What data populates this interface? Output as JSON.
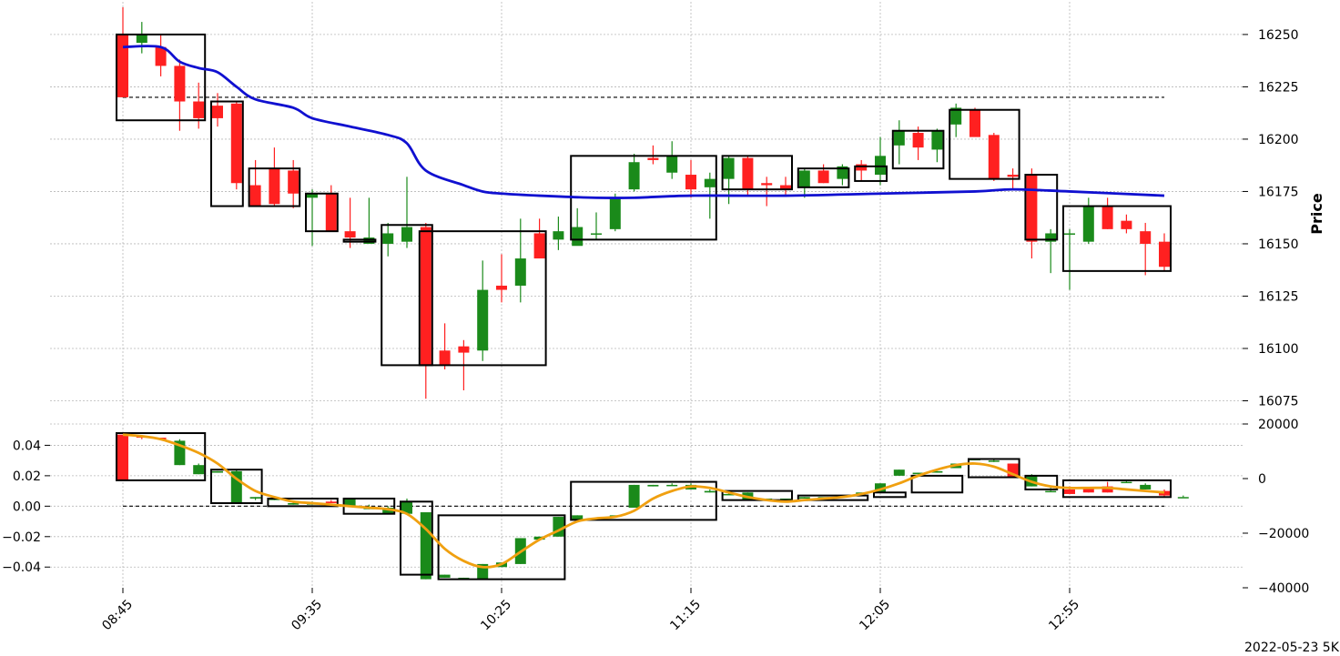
{
  "chart_data": [
    {
      "type": "candlestick",
      "panel": "price",
      "ylabel": "Price",
      "ylim": [
        16070,
        16263
      ],
      "yticks": [
        16075,
        16100,
        16125,
        16150,
        16175,
        16200,
        16225,
        16250
      ],
      "reference_line": 16220,
      "x_tick_labels": [
        "08:45",
        "09:35",
        "10:25",
        "11:15",
        "12:05",
        "12:55"
      ],
      "x_tick_indices": [
        0,
        10,
        20,
        30,
        40,
        50
      ],
      "colors": {
        "up": "#1a8a1a",
        "down": "#ff2020",
        "avg_line": "#1010d0",
        "box": "#000000",
        "ref_line": "#000000"
      },
      "candles": [
        [
          16250,
          16263,
          16220,
          16220
        ],
        [
          16246,
          16256,
          16241,
          16250
        ],
        [
          16244,
          16250,
          16230,
          16235
        ],
        [
          16235,
          16238,
          16204,
          16218
        ],
        [
          16218,
          16227,
          16205,
          16210
        ],
        [
          16216,
          16222,
          16206,
          16210
        ],
        [
          16217,
          16218,
          16176,
          16179
        ],
        [
          16178,
          16190,
          16168,
          16168
        ],
        [
          16186,
          16196,
          16168,
          16169
        ],
        [
          16185,
          16190,
          16167,
          16174
        ],
        [
          16172,
          16176,
          16149,
          16174
        ],
        [
          16174,
          16178,
          16158,
          16156
        ],
        [
          16156,
          16172,
          16148,
          16153
        ],
        [
          16150,
          16172,
          16151,
          16153
        ],
        [
          16150,
          16160,
          16144,
          16155
        ],
        [
          16151,
          16182,
          16148,
          16158
        ],
        [
          16158,
          16160,
          16076,
          16092
        ],
        [
          16099,
          16112,
          16090,
          16092
        ],
        [
          16101,
          16104,
          16080,
          16098
        ],
        [
          16099,
          16142,
          16094,
          16128
        ],
        [
          16130,
          16145,
          16122,
          16128
        ],
        [
          16130,
          16162,
          16122,
          16143
        ],
        [
          16155,
          16162,
          16145,
          16143
        ],
        [
          16152,
          16163,
          16147,
          16156
        ],
        [
          16149,
          16167,
          16152,
          16158
        ],
        [
          16155,
          16165,
          16152,
          16155
        ],
        [
          16157,
          16174,
          16156,
          16172
        ],
        [
          16176,
          16193,
          16175,
          16189
        ],
        [
          16191,
          16197,
          16188,
          16190
        ],
        [
          16184,
          16199,
          16181,
          16192
        ],
        [
          16183,
          16190,
          16172,
          16176
        ],
        [
          16177,
          16184,
          16162,
          16181
        ],
        [
          16181,
          16192,
          16169,
          16191
        ],
        [
          16191,
          16192,
          16173,
          16176
        ],
        [
          16179,
          16182,
          16168,
          16178
        ],
        [
          16178,
          16182,
          16173,
          16176
        ],
        [
          16177,
          16186,
          16172,
          16185
        ],
        [
          16185,
          16188,
          16179,
          16179
        ],
        [
          16181,
          16188,
          16178,
          16187
        ],
        [
          16188,
          16190,
          16180,
          16185
        ],
        [
          16183,
          16201,
          16178,
          16192
        ],
        [
          16197,
          16209,
          16188,
          16204
        ],
        [
          16203,
          16206,
          16190,
          16196
        ],
        [
          16195,
          16205,
          16189,
          16204
        ],
        [
          16207,
          16217,
          16201,
          16215
        ],
        [
          16214,
          16215,
          16202,
          16201
        ],
        [
          16202,
          16203,
          16180,
          16181
        ],
        [
          16183,
          16186,
          16176,
          16182
        ],
        [
          16183,
          16186,
          16143,
          16151
        ],
        [
          16151,
          16157,
          16136,
          16155
        ],
        [
          16155,
          16157,
          16128,
          16155
        ],
        [
          16151,
          16172,
          16150,
          16168
        ],
        [
          16168,
          16172,
          16157,
          16157
        ],
        [
          16161,
          16164,
          16155,
          16157
        ],
        [
          16156,
          16160,
          16135,
          16150
        ],
        [
          16151,
          16155,
          16137,
          16139
        ]
      ],
      "avg_line": [
        [
          0,
          16244
        ],
        [
          2,
          16244
        ],
        [
          3,
          16237
        ],
        [
          4,
          16234
        ],
        [
          5,
          16232
        ],
        [
          6,
          16225
        ],
        [
          7,
          16219
        ],
        [
          9,
          16215
        ],
        [
          10,
          16210
        ],
        [
          12,
          16206
        ],
        [
          14,
          16202
        ],
        [
          15,
          16198
        ],
        [
          16,
          16185
        ],
        [
          18,
          16178
        ],
        [
          19,
          16175
        ],
        [
          20,
          16174
        ],
        [
          22,
          16173
        ],
        [
          25,
          16172
        ],
        [
          27,
          16172
        ],
        [
          30,
          16173
        ],
        [
          35,
          16173
        ],
        [
          40,
          16174
        ],
        [
          45,
          16175
        ],
        [
          47,
          16176
        ],
        [
          50,
          16175
        ],
        [
          55,
          16173
        ]
      ],
      "boxes": [
        [
          0,
          3,
          16250,
          16209
        ],
        [
          3,
          6,
          16218,
          16168
        ],
        [
          6,
          7,
          16186,
          16168
        ],
        [
          7,
          9,
          16174,
          16156
        ],
        [
          9,
          11,
          16152,
          16151
        ],
        [
          11,
          12,
          16159,
          16092
        ],
        [
          12,
          17,
          16156,
          16092
        ],
        [
          17,
          24,
          16192,
          16152
        ],
        [
          24,
          28,
          16192,
          16176
        ],
        [
          28,
          29,
          16186,
          16177
        ],
        [
          29,
          30,
          16187,
          16180
        ],
        [
          30,
          33,
          16204,
          16186
        ],
        [
          33,
          36,
          16214,
          16181
        ],
        [
          36,
          37,
          16183,
          16152
        ],
        [
          37,
          41,
          16168,
          16137
        ]
      ]
    },
    {
      "type": "candlestick",
      "panel": "indicator",
      "left_ylim": [
        -0.0536,
        0.054
      ],
      "left_yticks": [
        0.04,
        0.02,
        0.0,
        -0.02,
        -0.04
      ],
      "left_ytick_labels": [
        "0.04",
        "0.02",
        "0.00",
        "−0.02",
        "−0.04"
      ],
      "right_ylim": [
        -40000,
        20000
      ],
      "right_yticks": [
        20000,
        0,
        -20000,
        -40000
      ],
      "right_ytick_labels": [
        "20000",
        "0",
        "−20000",
        "−40000"
      ],
      "reference_line": 0.0,
      "colors": {
        "up": "#1a8a1a",
        "down": "#ff2020",
        "avg_line": "#f0a010",
        "box": "#000000"
      },
      "candles": [
        [
          0.047,
          0.047,
          0.017,
          0.017
        ],
        [
          0.046,
          0.046,
          0.044,
          0.045
        ],
        [
          0.045,
          0.045,
          0.044,
          0.044
        ],
        [
          0.027,
          0.044,
          0.027,
          0.043
        ],
        [
          0.021,
          0.028,
          0.021,
          0.027
        ],
        [
          0.022,
          0.023,
          0.022,
          0.023
        ],
        [
          0.002,
          0.024,
          0.002,
          0.023
        ],
        [
          0.005,
          0.006,
          0.004,
          0.006
        ],
        [
          0.004,
          0.006,
          0.004,
          0.005
        ],
        [
          0.001,
          0.003,
          0.001,
          0.002
        ],
        [
          0.001,
          0.003,
          0.001,
          0.002
        ],
        [
          0.003,
          0.004,
          0.002,
          0.002
        ],
        [
          0.0,
          0.005,
          0.0,
          0.005
        ],
        [
          -0.002,
          0.001,
          -0.002,
          -0.001
        ],
        [
          -0.005,
          0.0,
          -0.005,
          -0.001
        ],
        [
          -0.005,
          0.005,
          -0.005,
          0.003
        ],
        [
          -0.048,
          -0.005,
          -0.048,
          -0.004
        ],
        [
          -0.047,
          -0.045,
          -0.047,
          -0.045
        ],
        [
          -0.048,
          -0.047,
          -0.048,
          -0.047
        ],
        [
          -0.048,
          -0.038,
          -0.048,
          -0.038
        ],
        [
          -0.04,
          -0.037,
          -0.04,
          -0.037
        ],
        [
          -0.038,
          -0.021,
          -0.038,
          -0.021
        ],
        [
          -0.022,
          -0.02,
          -0.022,
          -0.02
        ],
        [
          -0.02,
          -0.007,
          -0.02,
          -0.007
        ],
        [
          -0.009,
          -0.006,
          -0.009,
          -0.006
        ],
        [
          -0.009,
          -0.008,
          -0.009,
          -0.008
        ],
        [
          -0.007,
          -0.006,
          -0.007,
          -0.006
        ],
        [
          -0.001,
          0.014,
          -0.001,
          0.014
        ],
        [
          0.013,
          0.014,
          0.013,
          0.014
        ],
        [
          0.014,
          0.015,
          0.014,
          0.014
        ],
        [
          0.011,
          0.015,
          0.011,
          0.014
        ],
        [
          0.009,
          0.011,
          0.009,
          0.01
        ],
        [
          0.008,
          0.01,
          0.008,
          0.008
        ],
        [
          0.004,
          0.009,
          0.004,
          0.009
        ],
        [
          0.004,
          0.005,
          0.004,
          0.005
        ],
        [
          0.005,
          0.005,
          0.005,
          0.005
        ],
        [
          0.005,
          0.006,
          0.005,
          0.006
        ],
        [
          0.006,
          0.006,
          0.006,
          0.006
        ],
        [
          0.007,
          0.007,
          0.007,
          0.007
        ],
        [
          0.008,
          0.009,
          0.008,
          0.009
        ],
        [
          0.009,
          0.015,
          0.009,
          0.015
        ],
        [
          0.02,
          0.024,
          0.02,
          0.024
        ],
        [
          0.021,
          0.022,
          0.021,
          0.022
        ],
        [
          0.022,
          0.023,
          0.022,
          0.023
        ],
        [
          0.025,
          0.028,
          0.025,
          0.028
        ],
        [
          0.031,
          0.031,
          0.031,
          0.031
        ],
        [
          0.03,
          0.031,
          0.029,
          0.03
        ],
        [
          0.028,
          0.028,
          0.019,
          0.019
        ],
        [
          0.013,
          0.021,
          0.013,
          0.02
        ],
        [
          0.01,
          0.012,
          0.01,
          0.01
        ],
        [
          0.011,
          0.013,
          0.008,
          0.008
        ],
        [
          0.012,
          0.012,
          0.009,
          0.009
        ],
        [
          0.013,
          0.016,
          0.009,
          0.009
        ],
        [
          0.016,
          0.017,
          0.016,
          0.016
        ],
        [
          0.011,
          0.015,
          0.011,
          0.014
        ],
        [
          0.01,
          0.011,
          0.006,
          0.007
        ],
        [
          0.006,
          0.007,
          0.006,
          0.006
        ]
      ],
      "avg_line": [
        [
          0,
          0.047
        ],
        [
          1,
          0.046
        ],
        [
          2,
          0.044
        ],
        [
          3,
          0.04
        ],
        [
          4,
          0.035
        ],
        [
          5,
          0.028
        ],
        [
          6,
          0.018
        ],
        [
          7,
          0.01
        ],
        [
          8,
          0.006
        ],
        [
          9,
          0.003
        ],
        [
          10,
          0.002
        ],
        [
          11,
          0.001
        ],
        [
          12,
          0.0
        ],
        [
          13,
          -0.001
        ],
        [
          14,
          -0.002
        ],
        [
          15,
          -0.005
        ],
        [
          16,
          -0.015
        ],
        [
          17,
          -0.028
        ],
        [
          18,
          -0.036
        ],
        [
          19,
          -0.04
        ],
        [
          20,
          -0.038
        ],
        [
          21,
          -0.03
        ],
        [
          22,
          -0.022
        ],
        [
          23,
          -0.016
        ],
        [
          24,
          -0.01
        ],
        [
          25,
          -0.008
        ],
        [
          26,
          -0.007
        ],
        [
          27,
          -0.003
        ],
        [
          28,
          0.005
        ],
        [
          29,
          0.01
        ],
        [
          30,
          0.013
        ],
        [
          31,
          0.012
        ],
        [
          32,
          0.009
        ],
        [
          33,
          0.006
        ],
        [
          34,
          0.004
        ],
        [
          35,
          0.003
        ],
        [
          36,
          0.004
        ],
        [
          37,
          0.005
        ],
        [
          38,
          0.006
        ],
        [
          39,
          0.008
        ],
        [
          40,
          0.011
        ],
        [
          41,
          0.015
        ],
        [
          42,
          0.02
        ],
        [
          43,
          0.024
        ],
        [
          44,
          0.027
        ],
        [
          45,
          0.028
        ],
        [
          46,
          0.026
        ],
        [
          47,
          0.021
        ],
        [
          48,
          0.016
        ],
        [
          49,
          0.013
        ],
        [
          50,
          0.012
        ],
        [
          51,
          0.012
        ],
        [
          52,
          0.012
        ],
        [
          53,
          0.011
        ],
        [
          54,
          0.01
        ],
        [
          55,
          0.009
        ]
      ],
      "boxes": [
        [
          0,
          3,
          0.048,
          0.017
        ],
        [
          3,
          6,
          0.024,
          0.002
        ],
        [
          6,
          9,
          0.005,
          0.0
        ],
        [
          9,
          11,
          0.005,
          -0.005
        ],
        [
          11,
          12,
          0.003,
          -0.045
        ],
        [
          12,
          17,
          -0.006,
          -0.048
        ],
        [
          17,
          24,
          0.016,
          -0.009
        ],
        [
          24,
          28,
          0.01,
          0.004
        ],
        [
          28,
          31,
          0.007,
          0.004
        ],
        [
          31,
          33,
          0.009,
          0.006
        ],
        [
          33,
          36,
          0.02,
          0.009
        ],
        [
          36,
          39,
          0.031,
          0.019
        ],
        [
          39,
          41,
          0.02,
          0.011
        ],
        [
          41,
          48,
          0.017,
          0.006
        ]
      ]
    }
  ],
  "footer": {
    "label": "2022-05-23 5K"
  }
}
